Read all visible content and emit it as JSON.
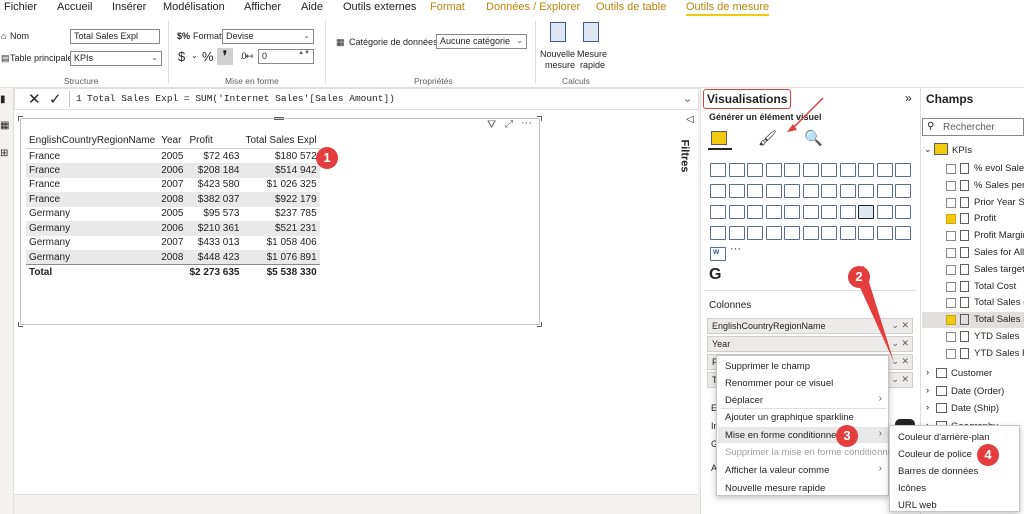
{
  "menubar": {
    "items": [
      "Fichier",
      "Accueil",
      "Insérer",
      "Modélisation",
      "Afficher",
      "Aide",
      "Outils externes",
      "Format",
      "Données / Explorer",
      "Outils de table",
      "Outils de mesure"
    ]
  },
  "ribbon": {
    "name_label": "Nom",
    "name_value": "Total Sales Expl",
    "home_table_label": "Table principale",
    "home_table_value": "KPIs",
    "structure_group": "Structure",
    "format_label": "Format",
    "format_value": "Devise",
    "currency_symbol": "$",
    "percent_symbol": "%",
    "decimals_value": "0",
    "formatting_group": "Mise en forme",
    "data_category_label": "Catégorie de données",
    "data_category_value": "Aucune catégorie",
    "properties_group": "Propriétés",
    "new_measure_label_1": "Nouvelle",
    "new_measure_label_2": "mesure",
    "quick_measure_label_1": "Mesure",
    "quick_measure_label_2": "rapide",
    "calculations_group": "Calculs"
  },
  "formula": {
    "line_number": "1",
    "text": "Total Sales Expl = SUM('Internet Sales'[Sales Amount])"
  },
  "table_visual": {
    "headers": [
      "EnglishCountryRegionName",
      "Year",
      "Profit",
      "Total Sales Expl"
    ],
    "rows": [
      [
        "France",
        "2005",
        "$72 463",
        "$180 572"
      ],
      [
        "France",
        "2006",
        "$208 184",
        "$514 942"
      ],
      [
        "France",
        "2007",
        "$423 580",
        "$1 026 325"
      ],
      [
        "France",
        "2008",
        "$382 037",
        "$922 179"
      ],
      [
        "Germany",
        "2005",
        "$95 573",
        "$237 785"
      ],
      [
        "Germany",
        "2006",
        "$210 361",
        "$521 231"
      ],
      [
        "Germany",
        "2007",
        "$433 013",
        "$1 058 406"
      ],
      [
        "Germany",
        "2008",
        "$448 423",
        "$1 076 891"
      ]
    ],
    "total": [
      "Total",
      "",
      "$2 273 635",
      "$5 538 330"
    ]
  },
  "badges": [
    "1",
    "2",
    "3",
    "4"
  ],
  "filters_tab": "Filtres",
  "viz_pane": {
    "title": "Visualisations",
    "subtitle": "Générer un élément visuel",
    "more": "···",
    "columns_label": "Colonnes",
    "wells": [
      "EnglishCountryRegionName",
      "Year",
      "Pr",
      "To"
    ],
    "partial_labels": [
      "Ex",
      "In",
      "G",
      "A"
    ]
  },
  "fields_pane": {
    "title": "Champs",
    "search_placeholder": "Rechercher",
    "table_kpis": "KPIs",
    "fields": [
      {
        "name": "% evol Sales vs",
        "checked": false
      },
      {
        "name": "% Sales per co",
        "checked": false
      },
      {
        "name": "Prior Year Sale",
        "checked": false
      },
      {
        "name": "Profit",
        "checked": true
      },
      {
        "name": "Profit Margin",
        "checked": false
      },
      {
        "name": "Sales for All C",
        "checked": false
      },
      {
        "name": "Sales target",
        "checked": false
      },
      {
        "name": "Total Cost",
        "checked": false
      },
      {
        "name": "Total Sales (by",
        "checked": false
      },
      {
        "name": "Total Sales Exp",
        "checked": true
      },
      {
        "name": "YTD Sales",
        "checked": false
      },
      {
        "name": "YTD Sales Fisc",
        "checked": false
      }
    ],
    "other_tables": [
      "Customer",
      "Date (Order)",
      "Date (Ship)",
      "Geography"
    ]
  },
  "context_menu": {
    "items": [
      "Supprimer le champ",
      "Renommer pour ce visuel",
      "Déplacer",
      "Ajouter un graphique sparkline",
      "Mise en forme conditionnelle",
      "Supprimer la mise en forme conditionnelle",
      "Afficher la valeur comme",
      "Nouvelle mesure rapide"
    ]
  },
  "submenu": {
    "items": [
      "Couleur d'arrière-plan",
      "Couleur de police",
      "Barres de données",
      "Icônes",
      "URL web"
    ]
  },
  "colors": {
    "accent": "#f2c811",
    "badge": "#e43d3d",
    "context_tab": "#b8860b",
    "powerbi_g": "#27ae60"
  }
}
